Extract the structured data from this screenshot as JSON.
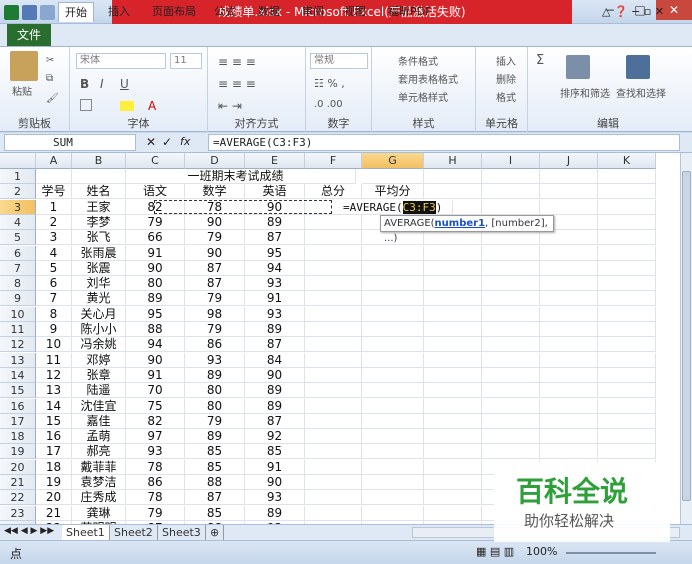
{
  "title": "成绩单.xlsx - Microsoft Excel(产品激活失败)",
  "tabs": [
    "开始",
    "插入",
    "页面布局",
    "公式",
    "数据",
    "审阅",
    "视图",
    "福昕PDF"
  ],
  "file_tab": "文件",
  "ribbon": {
    "groups": [
      "剪贴板",
      "字体",
      "对齐方式",
      "数字",
      "样式",
      "单元格",
      "编辑"
    ],
    "paste": "粘贴",
    "font_name": "宋体",
    "font_size": "11",
    "number_format": "常规",
    "cond_format": "条件格式",
    "table_format": "套用表格格式",
    "cell_style": "单元格样式",
    "insert": "插入",
    "delete": "删除",
    "format": "格式",
    "sort_filter": "排序和筛选",
    "find_select": "查找和选择",
    "bold": "B",
    "italic": "I",
    "underline": "U"
  },
  "formula_bar": {
    "name_box": "SUM",
    "formula": "=AVERAGE(C3:F3)"
  },
  "columns": [
    "A",
    "B",
    "C",
    "D",
    "E",
    "F",
    "G",
    "H",
    "I",
    "J",
    "K"
  ],
  "sheet_title": "一班期末考试成绩",
  "headers": [
    "学号",
    "姓名",
    "语文",
    "数学",
    "英语",
    "总分",
    "平均分"
  ],
  "rows": [
    [
      "1",
      "王家",
      "82",
      "78",
      "90"
    ],
    [
      "2",
      "李梦",
      "79",
      "90",
      "89"
    ],
    [
      "3",
      "张飞",
      "66",
      "79",
      "87"
    ],
    [
      "4",
      "张雨晨",
      "91",
      "90",
      "95"
    ],
    [
      "5",
      "张震",
      "90",
      "87",
      "94"
    ],
    [
      "6",
      "刘华",
      "80",
      "87",
      "93"
    ],
    [
      "7",
      "黄光",
      "89",
      "79",
      "91"
    ],
    [
      "8",
      "关心月",
      "95",
      "98",
      "93"
    ],
    [
      "9",
      "陈小小",
      "88",
      "79",
      "89"
    ],
    [
      "10",
      "冯余姚",
      "94",
      "86",
      "87"
    ],
    [
      "11",
      "邓婷",
      "90",
      "93",
      "84"
    ],
    [
      "12",
      "张章",
      "91",
      "89",
      "90"
    ],
    [
      "13",
      "陆遥",
      "70",
      "80",
      "89"
    ],
    [
      "14",
      "沈佳宜",
      "75",
      "80",
      "89"
    ],
    [
      "15",
      "嘉佳",
      "82",
      "79",
      "87"
    ],
    [
      "16",
      "孟萌",
      "97",
      "89",
      "92"
    ],
    [
      "17",
      "郝亮",
      "93",
      "85",
      "85"
    ],
    [
      "18",
      "戴菲菲",
      "78",
      "85",
      "91"
    ],
    [
      "19",
      "袁梦洁",
      "86",
      "88",
      "90"
    ],
    [
      "20",
      "庄秀成",
      "78",
      "87",
      "93"
    ],
    [
      "21",
      "龚琳",
      "79",
      "85",
      "89"
    ],
    [
      "22",
      "蔡明明",
      "87",
      "88",
      "93"
    ]
  ],
  "editing_cell": {
    "prefix": "=AVERAGE(",
    "range": "C3:F3",
    "suffix": ")"
  },
  "tooltip": {
    "fn": "AVERAGE(",
    "arg1": "number1",
    "rest": ", [number2], ...)"
  },
  "sheets": [
    "Sheet1",
    "Sheet2",
    "Sheet3"
  ],
  "status": {
    "mode": "点",
    "zoom": "100%"
  },
  "watermark": {
    "line1": "百科全说",
    "line2": "助你轻松解决"
  }
}
